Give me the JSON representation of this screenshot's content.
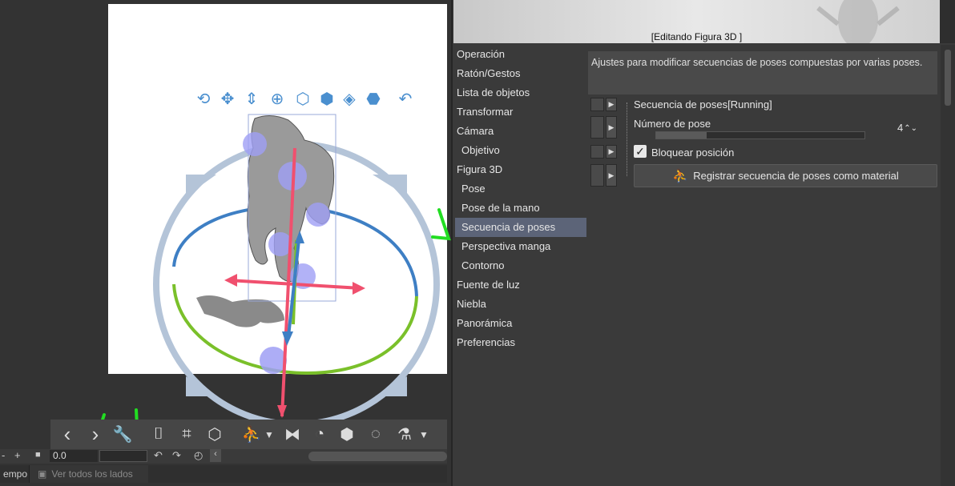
{
  "preview": {
    "label": "[Editando Figura 3D ]"
  },
  "menu": {
    "items": [
      {
        "label": "Operación",
        "sub": false
      },
      {
        "label": "Ratón/Gestos",
        "sub": false
      },
      {
        "label": "Lista de objetos",
        "sub": false
      },
      {
        "label": "Transformar",
        "sub": false
      },
      {
        "label": "Cámara",
        "sub": false
      },
      {
        "label": "Objetivo",
        "sub": true
      },
      {
        "label": "Figura 3D",
        "sub": false
      },
      {
        "label": "Pose",
        "sub": true
      },
      {
        "label": "Pose de la mano",
        "sub": true
      },
      {
        "label": "Secuencia de poses",
        "sub": true,
        "active": true
      },
      {
        "label": "Perspectiva manga",
        "sub": true
      },
      {
        "label": "Contorno",
        "sub": true
      },
      {
        "label": "Fuente de luz",
        "sub": false
      },
      {
        "label": "Niebla",
        "sub": false
      },
      {
        "label": "Panorámica",
        "sub": false
      },
      {
        "label": "Preferencias",
        "sub": false
      }
    ]
  },
  "description": "Ajustes para modificar secuencias de poses compuestas por varias poses.",
  "properties": {
    "sequence_label": "Secuencia de poses[Running]",
    "pose_number_label": "Número de pose",
    "pose_number_value": "4",
    "lock_position_label": "Bloquear posición",
    "lock_position_checked": true,
    "register_button": "Registrar secuencia de poses como material"
  },
  "bottom": {
    "time_value": "0.0",
    "tab1": "empo",
    "tab2": "Ver todos los lados"
  },
  "colors": {
    "accent_blue": "#4a8fcf",
    "menu_active": "#5c6478",
    "annotation_green": "#22dd22",
    "gizmo_red": "#f0506e",
    "gizmo_green": "#7ac02a",
    "gizmo_ring": "#b4c4d8"
  }
}
